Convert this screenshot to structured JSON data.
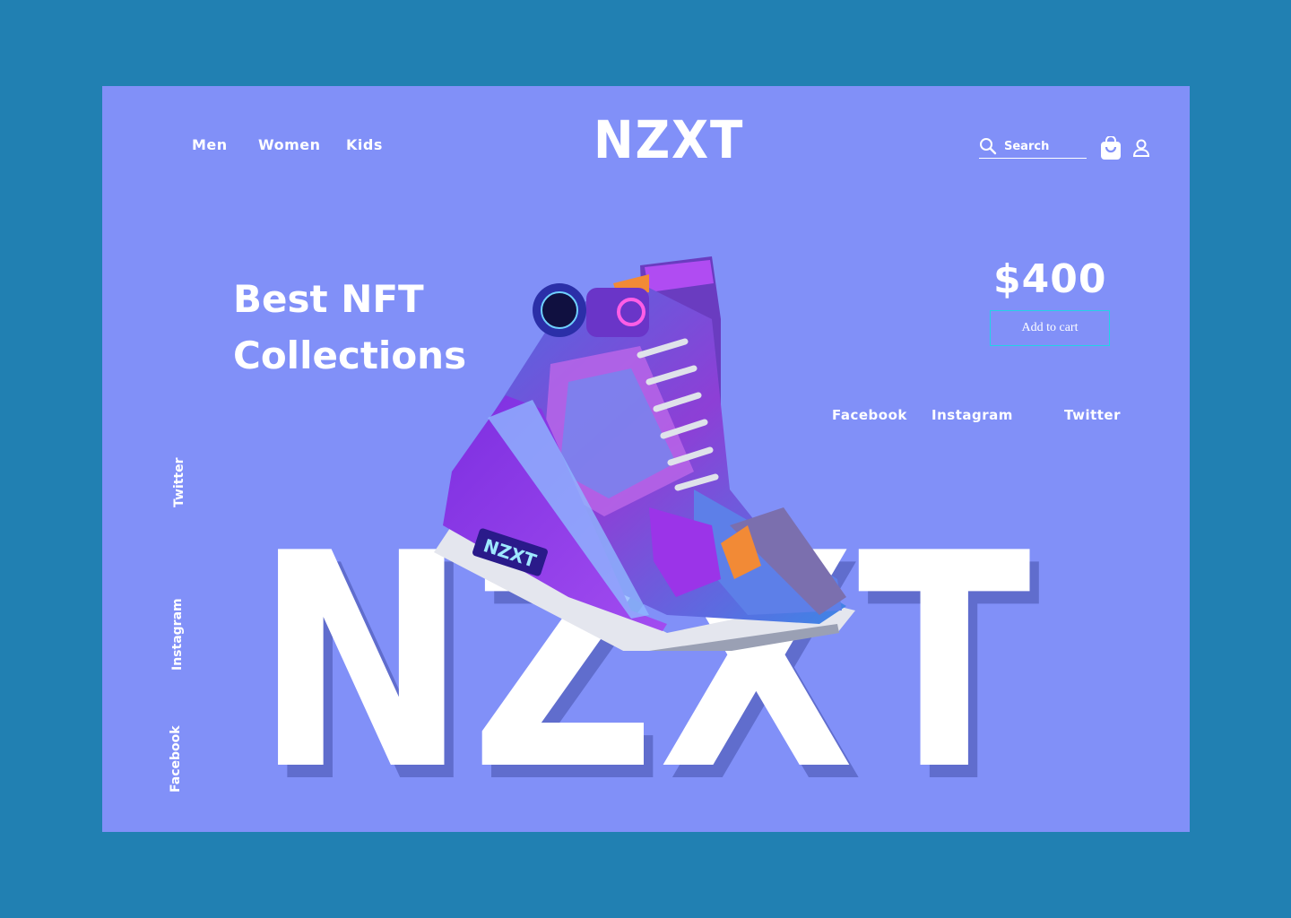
{
  "nav": {
    "men": "Men",
    "women": "Women",
    "kids": "Kids"
  },
  "brand": {
    "logo": "NZXT",
    "big_watermark": "NZXT",
    "shoe_badge": "NZXT"
  },
  "search": {
    "placeholder": "Search"
  },
  "hero": {
    "line1": "Best NFT",
    "line2": "Collections"
  },
  "product": {
    "price": "$400",
    "add_to_cart": "Add to cart"
  },
  "social_row": {
    "facebook": "Facebook",
    "instagram": "Instagram",
    "twitter": "Twitter"
  },
  "social_vertical": {
    "twitter": "Twitter",
    "instagram": "Instagram",
    "facebook": "Facebook"
  },
  "icons": [
    "search-icon",
    "shopping-bag-icon",
    "user-icon"
  ],
  "colors": {
    "outer": "#2180b2",
    "panel": "#8190f8",
    "accent_border": "#22d3e6",
    "text": "#ffffff"
  }
}
